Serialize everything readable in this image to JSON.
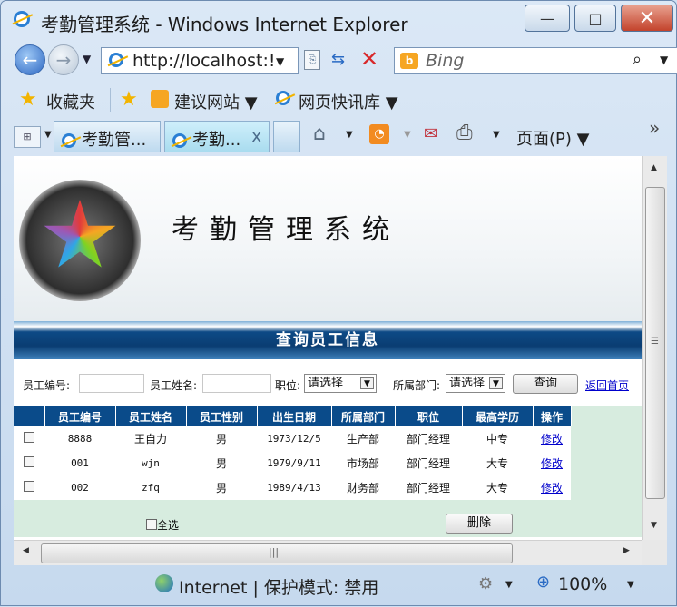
{
  "window": {
    "title": "考勤管理系统 - Windows Internet Explorer",
    "minimize": "—",
    "maximize": "□",
    "close": "✕"
  },
  "nav": {
    "address": "http://localhost:!",
    "search_placeholder": "Bing"
  },
  "favorites": {
    "label": "收藏夹",
    "items": [
      "建议网站 ▼",
      "网页快讯库 ▼"
    ]
  },
  "tabs": {
    "items": [
      "考勤管...",
      "考勤..."
    ],
    "close": "x",
    "page_menu": "页面(P) ▼"
  },
  "page": {
    "system_title": "考勤管理系统",
    "section_title": "查询员工信息",
    "filter": {
      "emp_id_label": "员工编号:",
      "emp_name_label": "员工姓名:",
      "position_label": "职位:",
      "position_value": "请选择",
      "dept_label": "所属部门:",
      "dept_value": "请选择",
      "query_button": "查询",
      "home_link": "返回首页"
    },
    "table": {
      "headers": [
        "员工编号",
        "员工姓名",
        "员工性别",
        "出生日期",
        "所属部门",
        "职位",
        "最高学历",
        "操作"
      ],
      "rows": [
        [
          "8888",
          "王自力",
          "男",
          "1973/12/5",
          "生产部",
          "部门经理",
          "中专",
          "修改"
        ],
        [
          "001",
          "wjn",
          "男",
          "1979/9/11",
          "市场部",
          "部门经理",
          "大专",
          "修改"
        ],
        [
          "002",
          "zfq",
          "男",
          "1989/4/13",
          "财务部",
          "部门经理",
          "大专",
          "修改"
        ]
      ]
    },
    "select_all": "全选",
    "delete_button": "删除"
  },
  "status": {
    "zone": "Internet | 保护模式: 禁用",
    "zoom": "100%"
  },
  "colors": {
    "header_blue": "#0a4b8a",
    "table_bg": "#d7ecdf",
    "link": "#0000cc",
    "close_red": "#c3432c"
  }
}
